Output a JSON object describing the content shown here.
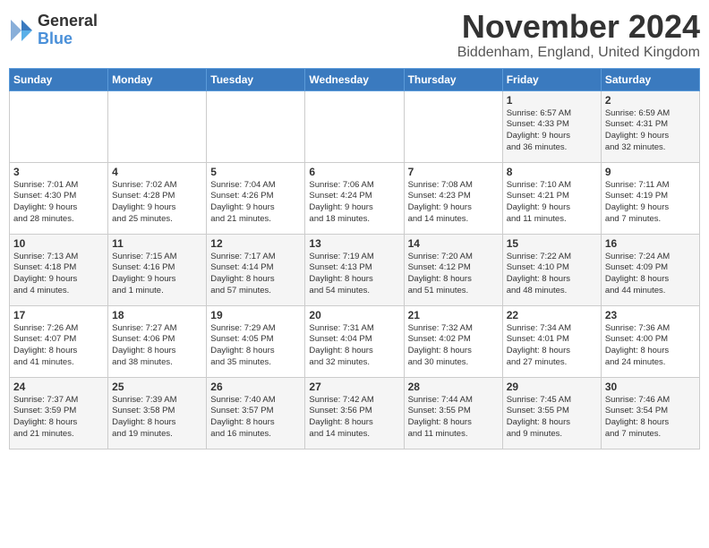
{
  "logo": {
    "general": "General",
    "blue": "Blue"
  },
  "title": "November 2024",
  "location": "Biddenham, England, United Kingdom",
  "headers": [
    "Sunday",
    "Monday",
    "Tuesday",
    "Wednesday",
    "Thursday",
    "Friday",
    "Saturday"
  ],
  "weeks": [
    [
      {
        "day": "",
        "info": ""
      },
      {
        "day": "",
        "info": ""
      },
      {
        "day": "",
        "info": ""
      },
      {
        "day": "",
        "info": ""
      },
      {
        "day": "",
        "info": ""
      },
      {
        "day": "1",
        "info": "Sunrise: 6:57 AM\nSunset: 4:33 PM\nDaylight: 9 hours\nand 36 minutes."
      },
      {
        "day": "2",
        "info": "Sunrise: 6:59 AM\nSunset: 4:31 PM\nDaylight: 9 hours\nand 32 minutes."
      }
    ],
    [
      {
        "day": "3",
        "info": "Sunrise: 7:01 AM\nSunset: 4:30 PM\nDaylight: 9 hours\nand 28 minutes."
      },
      {
        "day": "4",
        "info": "Sunrise: 7:02 AM\nSunset: 4:28 PM\nDaylight: 9 hours\nand 25 minutes."
      },
      {
        "day": "5",
        "info": "Sunrise: 7:04 AM\nSunset: 4:26 PM\nDaylight: 9 hours\nand 21 minutes."
      },
      {
        "day": "6",
        "info": "Sunrise: 7:06 AM\nSunset: 4:24 PM\nDaylight: 9 hours\nand 18 minutes."
      },
      {
        "day": "7",
        "info": "Sunrise: 7:08 AM\nSunset: 4:23 PM\nDaylight: 9 hours\nand 14 minutes."
      },
      {
        "day": "8",
        "info": "Sunrise: 7:10 AM\nSunset: 4:21 PM\nDaylight: 9 hours\nand 11 minutes."
      },
      {
        "day": "9",
        "info": "Sunrise: 7:11 AM\nSunset: 4:19 PM\nDaylight: 9 hours\nand 7 minutes."
      }
    ],
    [
      {
        "day": "10",
        "info": "Sunrise: 7:13 AM\nSunset: 4:18 PM\nDaylight: 9 hours\nand 4 minutes."
      },
      {
        "day": "11",
        "info": "Sunrise: 7:15 AM\nSunset: 4:16 PM\nDaylight: 9 hours\nand 1 minute."
      },
      {
        "day": "12",
        "info": "Sunrise: 7:17 AM\nSunset: 4:14 PM\nDaylight: 8 hours\nand 57 minutes."
      },
      {
        "day": "13",
        "info": "Sunrise: 7:19 AM\nSunset: 4:13 PM\nDaylight: 8 hours\nand 54 minutes."
      },
      {
        "day": "14",
        "info": "Sunrise: 7:20 AM\nSunset: 4:12 PM\nDaylight: 8 hours\nand 51 minutes."
      },
      {
        "day": "15",
        "info": "Sunrise: 7:22 AM\nSunset: 4:10 PM\nDaylight: 8 hours\nand 48 minutes."
      },
      {
        "day": "16",
        "info": "Sunrise: 7:24 AM\nSunset: 4:09 PM\nDaylight: 8 hours\nand 44 minutes."
      }
    ],
    [
      {
        "day": "17",
        "info": "Sunrise: 7:26 AM\nSunset: 4:07 PM\nDaylight: 8 hours\nand 41 minutes."
      },
      {
        "day": "18",
        "info": "Sunrise: 7:27 AM\nSunset: 4:06 PM\nDaylight: 8 hours\nand 38 minutes."
      },
      {
        "day": "19",
        "info": "Sunrise: 7:29 AM\nSunset: 4:05 PM\nDaylight: 8 hours\nand 35 minutes."
      },
      {
        "day": "20",
        "info": "Sunrise: 7:31 AM\nSunset: 4:04 PM\nDaylight: 8 hours\nand 32 minutes."
      },
      {
        "day": "21",
        "info": "Sunrise: 7:32 AM\nSunset: 4:02 PM\nDaylight: 8 hours\nand 30 minutes."
      },
      {
        "day": "22",
        "info": "Sunrise: 7:34 AM\nSunset: 4:01 PM\nDaylight: 8 hours\nand 27 minutes."
      },
      {
        "day": "23",
        "info": "Sunrise: 7:36 AM\nSunset: 4:00 PM\nDaylight: 8 hours\nand 24 minutes."
      }
    ],
    [
      {
        "day": "24",
        "info": "Sunrise: 7:37 AM\nSunset: 3:59 PM\nDaylight: 8 hours\nand 21 minutes."
      },
      {
        "day": "25",
        "info": "Sunrise: 7:39 AM\nSunset: 3:58 PM\nDaylight: 8 hours\nand 19 minutes."
      },
      {
        "day": "26",
        "info": "Sunrise: 7:40 AM\nSunset: 3:57 PM\nDaylight: 8 hours\nand 16 minutes."
      },
      {
        "day": "27",
        "info": "Sunrise: 7:42 AM\nSunset: 3:56 PM\nDaylight: 8 hours\nand 14 minutes."
      },
      {
        "day": "28",
        "info": "Sunrise: 7:44 AM\nSunset: 3:55 PM\nDaylight: 8 hours\nand 11 minutes."
      },
      {
        "day": "29",
        "info": "Sunrise: 7:45 AM\nSunset: 3:55 PM\nDaylight: 8 hours\nand 9 minutes."
      },
      {
        "day": "30",
        "info": "Sunrise: 7:46 AM\nSunset: 3:54 PM\nDaylight: 8 hours\nand 7 minutes."
      }
    ]
  ]
}
